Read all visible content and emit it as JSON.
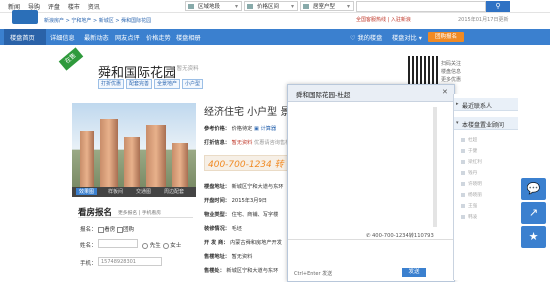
{
  "topnav": [
    "新闻",
    "导购",
    "评盘",
    "楼市",
    "资讯"
  ],
  "breadcrumb": "新浪房产 > 宁和地产 > 新城区 > 舜和国际花园",
  "filters": {
    "district": "区域地段",
    "price": "价格区间",
    "type": "居室户型"
  },
  "hotline_top": "全国客服热线 | 入驻新浪",
  "top_date": "2015年01月17日更新",
  "bluenav": [
    "楼盘首页",
    "详细信息",
    "最新动态",
    "网友点评",
    "价格走势",
    "楼盘相册"
  ],
  "mine": [
    "我的楼盘",
    "楼盘对比"
  ],
  "join_label": "团购报名",
  "ribbon": "在售",
  "project_name": "舜和国际花园",
  "price_hint": "暂无资料",
  "tags": [
    "打折优惠",
    "配套完善",
    "全景地产",
    "小户型"
  ],
  "qr_text": [
    "扫码关注",
    "楼盘信息",
    "更多优惠"
  ],
  "photo_tabs": [
    "效果图",
    "样板间",
    "交通图",
    "周边配套"
  ],
  "registration": {
    "title": "看房报名",
    "link": "更多报名 | 手机看房",
    "intent_label": "报名：",
    "intent_opts": [
      "看房",
      "团购"
    ],
    "name_label": "姓名：",
    "gender": [
      "先生",
      "女士"
    ],
    "phone_label": "手机：",
    "phone_placeholder": "15748928301"
  },
  "headline": "经济住宅 小户型 景观",
  "info": {
    "ref_price_k": "参考价格：",
    "ref_price_v": "价格待定",
    "ref_price_btn": "计算器",
    "discount_k": "打折信息：",
    "discount_v": "暂无资料",
    "discount_note": "优惠请咨询售楼处",
    "hotline": "400-700-1234 转 6",
    "addr_k": "楼盘地址：",
    "addr_v": "新城区宁和大道与东环",
    "open_k": "开盘时间：",
    "open_v": "2015年3月9日",
    "prop_k": "物业类型：",
    "prop_v": "住宅、商铺、写字楼",
    "deco_k": "装修情况：",
    "deco_v": "毛坯",
    "dev_k": "开 发 商：",
    "dev_v": "内蒙古舜和房地产开发",
    "sale_k": "售楼地址：",
    "sale_v": "暂无资料",
    "show_k": "售楼处：",
    "show_v": "新城区宁和大道与东环"
  },
  "chat": {
    "title": "舜和国际花园-杜超",
    "phone": "400-700-1234转110793",
    "hint": "Ctrl+Enter 发送",
    "send": "发送"
  },
  "side": {
    "recent": "最近联系人",
    "consultants_title": "本楼盘置业顾问",
    "consultants": [
      "杜超",
      "于健",
      "梁红利",
      "钱丹",
      "许晓明",
      "杨晓丽",
      "王强",
      "韩凌"
    ]
  },
  "float_icons": [
    "chat-icon",
    "share-icon",
    "star-icon"
  ]
}
